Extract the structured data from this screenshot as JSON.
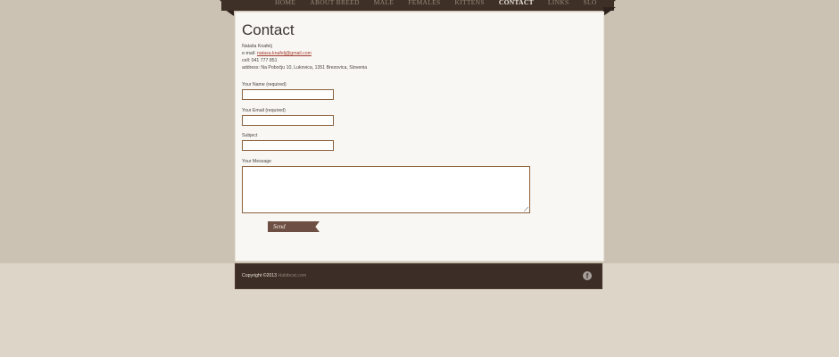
{
  "nav": {
    "items": [
      {
        "label": "HOME"
      },
      {
        "label": "ABOUT BREED"
      },
      {
        "label": "MALE"
      },
      {
        "label": "FEMALES"
      },
      {
        "label": "KITTENS"
      },
      {
        "label": "CONTACT",
        "active": true
      },
      {
        "label": "LINKS"
      },
      {
        "label": "SLO"
      }
    ]
  },
  "page": {
    "title": "Contact"
  },
  "contact": {
    "name": "Nataša Knafelj",
    "email_label": "e-mail:",
    "email": "natasa.knafelj@gmail.com",
    "cell": "cell: 041 777 851",
    "address": "address: Na Pobočju 10, Lukovica, 1351 Brezovica, Slovenia"
  },
  "form": {
    "name_label": "Your Name (required)",
    "name_value": "",
    "email_label": "Your Email (required)",
    "email_value": "",
    "subject_label": "Subject",
    "subject_value": "",
    "message_label": "Your Message",
    "message_value": "",
    "send_label": "Send"
  },
  "footer": {
    "copyright": "Copyright ©2013",
    "site": "Habibcat.com",
    "social_icon": "facebook-icon"
  },
  "colors": {
    "ribbon": "#3e2f27",
    "panel": "#f8f7f3",
    "field_border": "#8a5f3a",
    "send_button": "#6e4f43",
    "footer": "#3c2e26",
    "link": "#a2392c"
  }
}
